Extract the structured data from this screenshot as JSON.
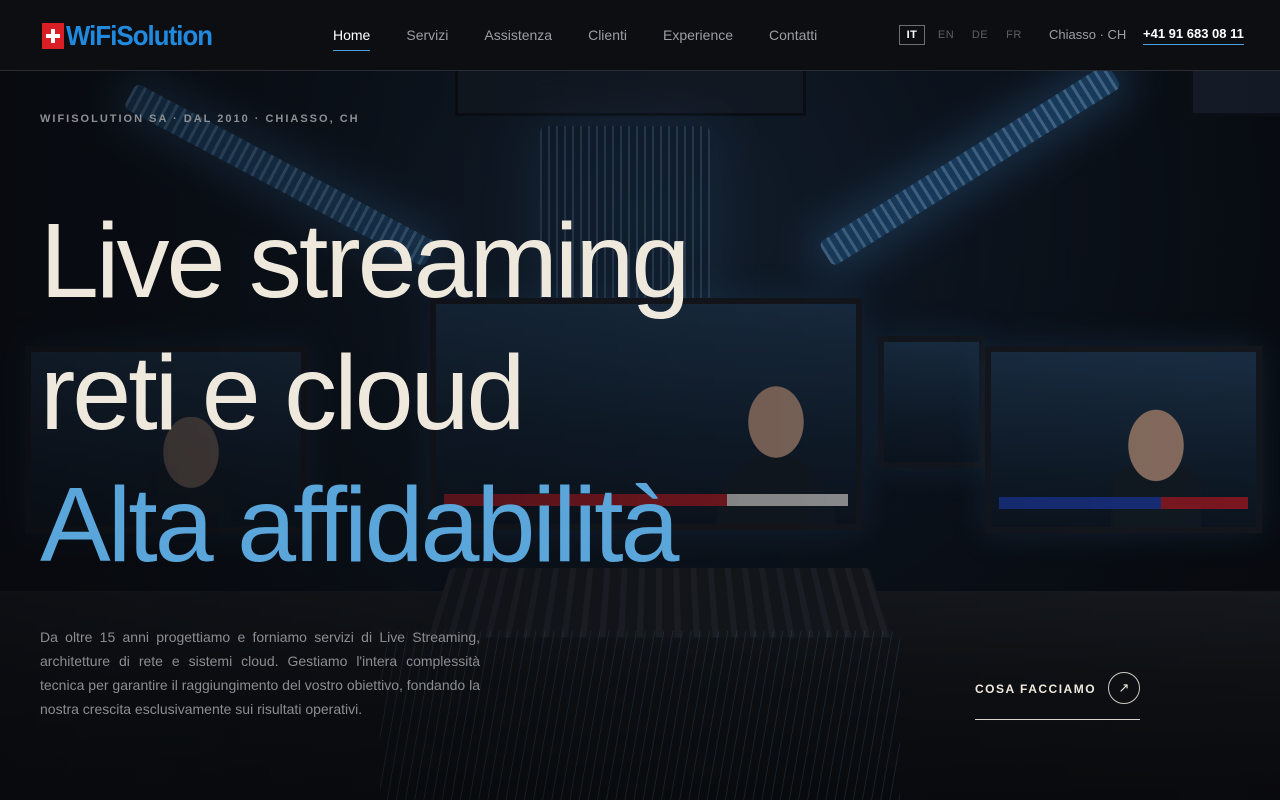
{
  "header": {
    "logo_text": "WiFiSolution",
    "nav": [
      {
        "label": "Home",
        "active": true
      },
      {
        "label": "Servizi",
        "active": false
      },
      {
        "label": "Assistenza",
        "active": false
      },
      {
        "label": "Clienti",
        "active": false
      },
      {
        "label": "Experience",
        "active": false
      },
      {
        "label": "Contatti",
        "active": false
      }
    ],
    "languages": [
      {
        "label": "IT",
        "active": true
      },
      {
        "label": "EN",
        "active": false
      },
      {
        "label": "DE",
        "active": false
      },
      {
        "label": "FR",
        "active": false
      }
    ],
    "location": "Chiasso · CH",
    "phone": "+41 91 683 08 11"
  },
  "hero": {
    "eyebrow": "WIFISOLUTION SA · DAL 2010 · CHIASSO, CH",
    "headline_line1": "Live streaming",
    "headline_line2": "reti e cloud",
    "headline_line3": "Alta affidabilità",
    "description": "Da oltre 15 anni progettiamo e forniamo servizi di Live Streaming, architetture di rete e sistemi cloud. Gestiamo l'intera complessità tecnica per garantire il raggiungimento del vostro obiettivo, fondando la nostra crescita esclusivamente sui risultati operativi.",
    "cta_label": "COSA FACCIAMO",
    "cta_icon": "↗"
  },
  "colors": {
    "accent": "#5aa6db",
    "brand_blue": "#1f8ae0",
    "brand_red": "#d91e26",
    "headline": "#efe9dd",
    "header_bg": "#0d0e11"
  },
  "icons": {
    "logo": "swiss-flag-icon",
    "cta": "arrow-up-right-icon"
  }
}
